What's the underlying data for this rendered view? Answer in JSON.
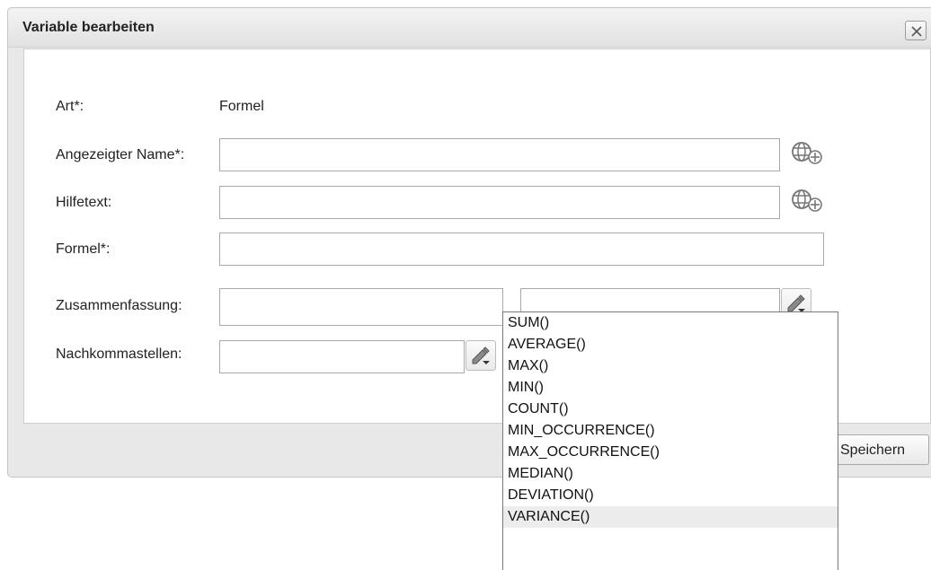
{
  "dialog": {
    "title": "Variable bearbeiten",
    "close_label": "✕"
  },
  "form": {
    "art": {
      "label": "Art*:",
      "value": "Formel"
    },
    "display_name": {
      "label": "Angezeigter Name*:",
      "value": ""
    },
    "help_text": {
      "label": "Hilfetext:",
      "value": ""
    },
    "formula": {
      "label": "Formel*:",
      "value": ""
    },
    "summary": {
      "label": "Zusammenfassung:",
      "value": "",
      "function_value": ""
    },
    "decimals": {
      "label": "Nachkommastellen:",
      "value": ""
    }
  },
  "footer": {
    "save_label": "Speichern"
  },
  "summary_dropdown": {
    "options": [
      "SUM()",
      "AVERAGE()",
      "MAX()",
      "MIN()",
      "COUNT()",
      "MIN_OCCURRENCE()",
      "MAX_OCCURRENCE()",
      "MEDIAN()",
      "DEVIATION()",
      "VARIANCE()"
    ],
    "highlighted": "VARIANCE()"
  },
  "icons": {
    "translate": "globe-add-icon",
    "edit": "pencil-dropdown-icon",
    "close": "close-icon"
  }
}
